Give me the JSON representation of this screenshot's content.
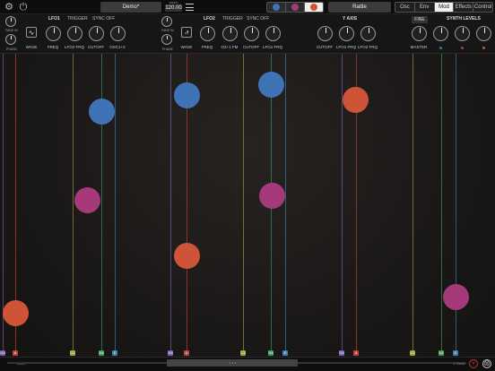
{
  "topbar": {
    "preset_name": "Demo*",
    "tempo_label": "TEMPO",
    "tempo_value": "120.00",
    "instrument_name": "Rattle",
    "voices": [
      {
        "name": "blue",
        "color": "#3f73b5"
      },
      {
        "name": "pink",
        "color": "#a5397a"
      },
      {
        "name": "orange",
        "color": "#cf5437"
      }
    ],
    "tabs": [
      "Osc",
      "Env",
      "Mod",
      "Effects",
      "Control"
    ],
    "active_tab": "Mod"
  },
  "controls": {
    "fade_in": "FADE IN",
    "phase": "PHASE",
    "lfo1": {
      "title": "LFO1",
      "trigger": "TRIGGER",
      "sync": "SYNC OFF",
      "knobs": [
        "WAVE",
        "FREQ",
        "LFO2 FRQ",
        "CUTOFF",
        "OSC1+2"
      ]
    },
    "lfo2": {
      "title": "LFO2",
      "trigger": "TRIGGER",
      "sync": "SYNC OFF",
      "knobs": [
        "WAVE",
        "FREQ",
        "O2+1 FM",
        "CUTOFF",
        "LFO1 FRQ"
      ]
    },
    "yaxis": {
      "title": "Y AXIS",
      "knobs": [
        "CUTOFF",
        "LFO1 FRQ",
        "LFO2 FRQ"
      ]
    },
    "synth_levels": {
      "title": "SYNTH LEVELS",
      "fine": "FINE",
      "master": "MASTER",
      "level_colors": [
        "#3f73b5",
        "#a5397a",
        "#cf5437"
      ]
    }
  },
  "field": {
    "strings": [
      {
        "note": "G4",
        "color": "#7a5fb0"
      },
      {
        "note": "A",
        "color": "#c2403a"
      },
      {
        "note": "C4",
        "color": "#9aa13a"
      },
      {
        "note": "D4",
        "color": "#3e9a56"
      },
      {
        "note": "E",
        "color": "#3d7fae"
      },
      {
        "note": "G4",
        "color": "#7a5fb0"
      },
      {
        "note": "A",
        "color": "#c2403a"
      },
      {
        "note": "C4",
        "color": "#9aa13a"
      },
      {
        "note": "D4",
        "color": "#3e9a56"
      },
      {
        "note": "E",
        "color": "#3d7fae"
      },
      {
        "note": "G4",
        "color": "#7a5fb0"
      },
      {
        "note": "A",
        "color": "#c2403a"
      },
      {
        "note": "C4",
        "color": "#9aa13a"
      },
      {
        "note": "D4",
        "color": "#3e9a56"
      },
      {
        "note": "E",
        "color": "#3d7fae"
      }
    ],
    "balls": [
      {
        "voice": "orange"
      },
      {
        "voice": "blue"
      },
      {
        "voice": "pink"
      },
      {
        "voice": "blue"
      },
      {
        "voice": "orange"
      },
      {
        "voice": "blue"
      },
      {
        "voice": "pink"
      },
      {
        "voice": "orange"
      },
      {
        "voice": "pink"
      }
    ]
  },
  "bottombar": {
    "left_octave": "Oktav",
    "right_octave": "1 Oktav",
    "close_symbol": "×",
    "reset_symbol": "⨂"
  }
}
